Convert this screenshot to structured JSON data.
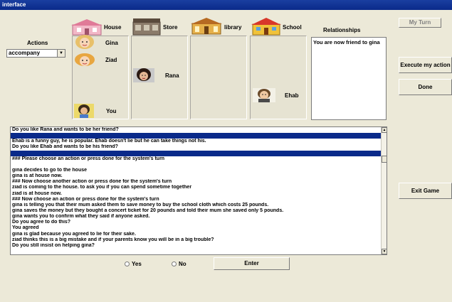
{
  "window": {
    "title": "interface"
  },
  "actions": {
    "label": "Actions",
    "selected": "accompany"
  },
  "locations": [
    {
      "id": "house",
      "label": "House"
    },
    {
      "id": "store",
      "label": "Store"
    },
    {
      "id": "library",
      "label": "library"
    },
    {
      "id": "school",
      "label": "School"
    }
  ],
  "characters": {
    "gina": "Gina",
    "ziad": "Ziad",
    "rana": "Rana",
    "ehab": "Ehab",
    "you": "You"
  },
  "relationships": {
    "label": "Relationships",
    "text": "You are now friend to gina"
  },
  "buttons": {
    "my_turn": "My Turn",
    "execute": "Execute my action",
    "done": "Done",
    "exit": "Exit Game",
    "enter": "Enter"
  },
  "answers": {
    "yes": "Yes",
    "no": "No"
  },
  "dialog": {
    "lines": [
      "Do you like Rana and wants to be her friend?",
      "",
      "Ehab is a funny guy, he is popular. Ehab doesn't lie but he can take things not his.",
      "Do you like Ehab and wants to be his friend?",
      "",
      "### Please choose an action or press done for the system's turn",
      "",
      "gina decides to go to the house",
      "gina is at house now.",
      "### Now choose another action or press done for the system's turn",
      "ziad is coming to the  house. to ask you if you can spend sometime together",
      "ziad is at house now.",
      "### Now choose an action or press done for the system's turn",
      "gina is telling you that their mum asked them to save money to buy the school cloth which costs 25 pounds.",
      "gina saves the money but they bought a concert ticket for 20 pounds and told their mum she saved only 5 pounds.",
      "gina wants you to confirm what they said if anyone asked.",
      "Do you agree to do this?",
      "You agreed",
      "gina is glad because you agreed to lie for their sake.",
      "ziad thinks this is a big mistake and if your parents know you will be in a big trouble?",
      "Do you still insist on helping gina?"
    ]
  },
  "colors": {
    "titlebar": "#0a2a8a",
    "highlight": "#0a2a8a",
    "panel": "#e6e3d2"
  }
}
